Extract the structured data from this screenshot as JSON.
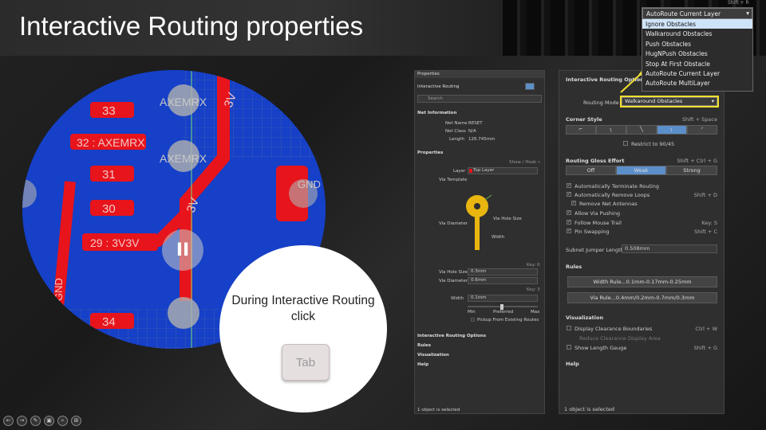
{
  "slide": {
    "title": "Interactive Routing properties",
    "hint": "During Interactive Routing click",
    "key": "Tab"
  },
  "pcb": {
    "labels": [
      "33",
      "32 : AXEMRX",
      "31",
      "30",
      "29 : 3V3V",
      "34",
      "AXEMRX",
      "AXEMRX",
      "3V",
      "3V",
      "GND",
      "GND"
    ],
    "colors": {
      "copper_top": "#e8141b",
      "copper_bottom": "#1540c7",
      "pad": "#b0b0b0"
    }
  },
  "properties_panel": {
    "title": "Properties",
    "mode": "Interactive Routing",
    "search_placeholder": "Search",
    "net_section": "Net Information",
    "net_name_label": "Net Name",
    "net_name": "RESET",
    "net_class_label": "Net Class",
    "net_class": "N/A",
    "length_label": "Length",
    "length": "126.745mm",
    "props_section": "Properties",
    "show_hide": "Show  /  Hook  »",
    "layer_label": "Layer",
    "layer": "Top Layer",
    "via_template": "Via Template",
    "via_diameter_lbl": "Via Diameter",
    "via_hole_lbl": "Via Hole Size",
    "width_lbl": "Width",
    "key_d": "Key: 0",
    "via_hole_size_label": "Via Hole Size",
    "via_hole_size": "0.3mm",
    "via_diameter_label": "Via Diameter",
    "via_diameter": "0.6mm",
    "key_3": "Key: 3",
    "width_label": "Width",
    "width": "0.1mm",
    "min": "Min",
    "preferred": "Preferred",
    "max": "Max",
    "pickup": "Pickup From Existing Routes",
    "sections": [
      "Interactive Routing Options",
      "Rules",
      "Visualization",
      "Help"
    ],
    "status": "1 object is selected"
  },
  "options_panel": {
    "section": "Interactive Routing Options",
    "routing_mode_label": "Routing Mode",
    "routing_mode": "Walkaround Obstacles",
    "corner_style_label": "Corner Style",
    "corner_style_shortcut": "Shift + Space",
    "restrict": "Restrict to 90/45",
    "gloss_label": "Routing Gloss Effort",
    "gloss_shortcut": "Shift + Ctrl + G",
    "gloss_options": [
      "Off",
      "Weak",
      "Strong"
    ],
    "checks": [
      {
        "label": "Automatically Terminate Routing",
        "shortcut": ""
      },
      {
        "label": "Automatically Remove Loops",
        "shortcut": "Shift + D"
      },
      {
        "label": "Remove Net Antennas",
        "shortcut": ""
      },
      {
        "label": "Allow Via Pushing",
        "shortcut": ""
      },
      {
        "label": "Follow Mouse Trail",
        "shortcut": "Key: S"
      },
      {
        "label": "Pin Swapping",
        "shortcut": "Shift + C"
      }
    ],
    "subnet_label": "Subnet Jumper Length",
    "subnet_value": "0.508mm",
    "rules_section": "Rules",
    "width_rule": "Width Rule...0.1mm-0.17mm-0.25mm",
    "via_rule": "Via Rule...0.4mm/0.2mm-0.7mm/0.3mm",
    "vis_section": "Visualization",
    "clearance": "Display Clearance Boundaries",
    "clearance_shortcut": "Ctrl + W",
    "reduce": "Reduce Clearance Display Area",
    "length_gauge": "Show Length Gauge",
    "length_gauge_shortcut": "Shift + G",
    "help_section": "Help",
    "status": "1 object is selected"
  },
  "dropdown": {
    "shortcut": "Shift + R",
    "current": "AutoRoute Current Layer",
    "options": [
      "Ignore Obstacles",
      "Walkaround Obstacles",
      "Push Obstacles",
      "HugNPush Obstacles",
      "Stop At First Obstacle",
      "AutoRoute Current Layer",
      "AutoRoute MultiLayer"
    ],
    "selected_index": 0
  },
  "controls": [
    "←",
    "→",
    "✎",
    "▣",
    "⌕",
    "⊞"
  ]
}
